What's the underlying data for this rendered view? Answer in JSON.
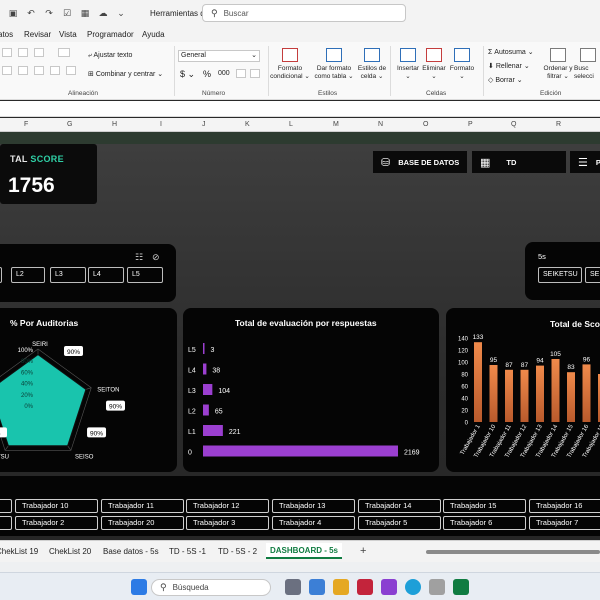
{
  "window": {
    "title": "Herramientas de Gesti...",
    "search_placeholder": "Buscar"
  },
  "menu": [
    "atos",
    "Revisar",
    "Vista",
    "Programador",
    "Ayuda"
  ],
  "ribbon": {
    "wrap_text": "Ajustar texto",
    "merge_center": "Combinar y centrar",
    "number_format": "General",
    "currency": "$",
    "percent": "%",
    "thousands": "000",
    "cond_format_1": "Formato",
    "cond_format_2": "condicional",
    "table_format_1": "Dar formato",
    "table_format_2": "como tabla",
    "cell_styles_1": "Estilos de",
    "cell_styles_2": "celda",
    "insert": "Insertar",
    "delete": "Eliminar",
    "format": "Formato",
    "autosum": "Autosuma",
    "fill": "Rellenar",
    "clear": "Borrar",
    "sort_1": "Ordenar y",
    "sort_2": "filtrar",
    "find_1": "Busc",
    "find_2": "selecci",
    "groups": {
      "alignment": "Alineación",
      "number": "Número",
      "styles": "Estilos",
      "cells": "Celdas",
      "editing": "Edición"
    }
  },
  "columns": [
    "F",
    "G",
    "H",
    "I",
    "J",
    "K",
    "L",
    "M",
    "N",
    "O",
    "P",
    "Q",
    "R"
  ],
  "dashboard": {
    "score_label_a": "TAL",
    "score_label_b": "SCORE",
    "score_value": "1756",
    "nav": {
      "db": "BASE DE DATOS",
      "td": "TD",
      "p": "P"
    },
    "slicer_left": {
      "items": [
        "L2",
        "L3",
        "L4",
        "L5"
      ]
    },
    "slicer_right": {
      "title": "5s",
      "items": [
        "SEIKETSU",
        "SEI"
      ]
    },
    "workers_row1": [
      "Trabajador 10",
      "Trabajador 11",
      "Trabajador 12",
      "Trabajador 13",
      "Trabajador 14",
      "Trabajador 15",
      "Trabajador 16"
    ],
    "workers_row2": [
      "Trabajador 2",
      "Trabajador 20",
      "Trabajador 3",
      "Trabajador 4",
      "Trabajador 5",
      "Trabajador 6",
      "Trabajador 7"
    ]
  },
  "chart_data": [
    {
      "type": "radar",
      "title": "% Por Auditorias",
      "axes": [
        "SEIRI",
        "SEITON",
        "SEISO",
        "KETSU",
        ""
      ],
      "ticks": [
        "100%",
        "80%",
        "60%",
        "40%",
        "20%",
        "0%"
      ],
      "series": [
        {
          "values": [
            90,
            90,
            90,
            90,
            90
          ]
        }
      ],
      "data_labels": [
        "90%",
        "90%",
        "90%",
        "%"
      ],
      "fill_color": "#19c4ad"
    },
    {
      "type": "bar",
      "orientation": "horizontal",
      "title": "Total de evaluación por respuestas",
      "categories": [
        "L5",
        "L4",
        "L3",
        "L2",
        "L1",
        "0"
      ],
      "values": [
        3,
        38,
        104,
        65,
        221,
        2169
      ],
      "xlim": [
        0,
        2169
      ],
      "color": "#9b3fd0"
    },
    {
      "type": "bar",
      "title": "Total de Sco",
      "categories": [
        "Trabajador 1",
        "Trabajador 10",
        "Trabajador 11",
        "Trabajador 12",
        "Trabajador 13",
        "Trabajador 14",
        "Trabajador 15",
        "Trabajador 16",
        "Trabajador 17",
        "Trabajador"
      ],
      "values": [
        133,
        95,
        87,
        87,
        94,
        105,
        83,
        96,
        80,
        80
      ],
      "data_labels": [
        "133",
        "95",
        "87",
        "87",
        "94",
        "105",
        "83",
        "96",
        "",
        ""
      ],
      "yticks": [
        "140",
        "120",
        "100",
        "80",
        "60",
        "40",
        "20",
        "0"
      ],
      "ylim": [
        0,
        140
      ],
      "color": "#e8773e"
    }
  ],
  "sheets": {
    "tabs": [
      "ChekList 19",
      "ChekList 20",
      "Base datos - 5s",
      "TD - 5S -1",
      "TD - 5S - 2",
      "DASHBOARD - 5s"
    ],
    "active": "DASHBOARD - 5s"
  },
  "taskbar": {
    "search": "Búsqueda"
  }
}
